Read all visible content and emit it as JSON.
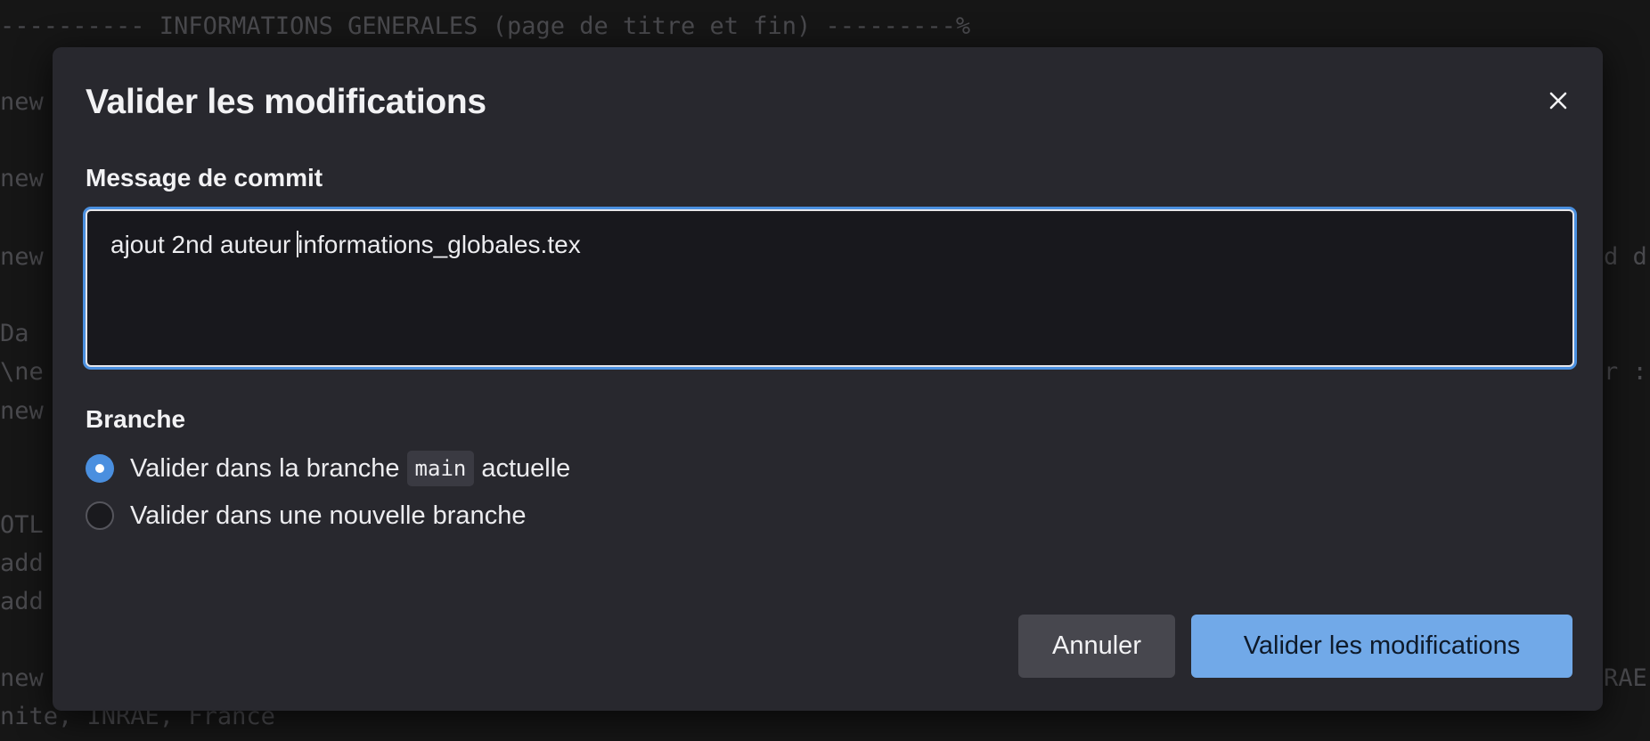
{
  "background_editor": {
    "lines": [
      "---------- INFORMATIONS GENERALES (page de titre et fin) ---------%",
      "new",
      "new",
      "new",
      "d d",
      "Da",
      "\\ne",
      "r :",
      "new",
      "OTL",
      "add",
      "add",
      "new",
      "RAE",
      "nite, INRAE, France"
    ]
  },
  "dialog": {
    "title": "Valider les modifications",
    "close_icon": "close-icon"
  },
  "commit": {
    "label": "Message de commit",
    "value_before_caret": "ajout 2nd auteur ",
    "value_after_caret": "informations_globales.tex"
  },
  "branch": {
    "label": "Branche",
    "options": [
      {
        "prefix": "Valider dans la branche",
        "branch_name": "main",
        "suffix": "actuelle",
        "selected": true
      },
      {
        "label": "Valider dans une nouvelle branche",
        "selected": false
      }
    ]
  },
  "buttons": {
    "cancel_label": "Annuler",
    "confirm_label": "Valider les modifications"
  },
  "colors": {
    "accent": "#4a8fdf",
    "primary_button": "#71a9e8",
    "modal_bg": "#28282e"
  }
}
